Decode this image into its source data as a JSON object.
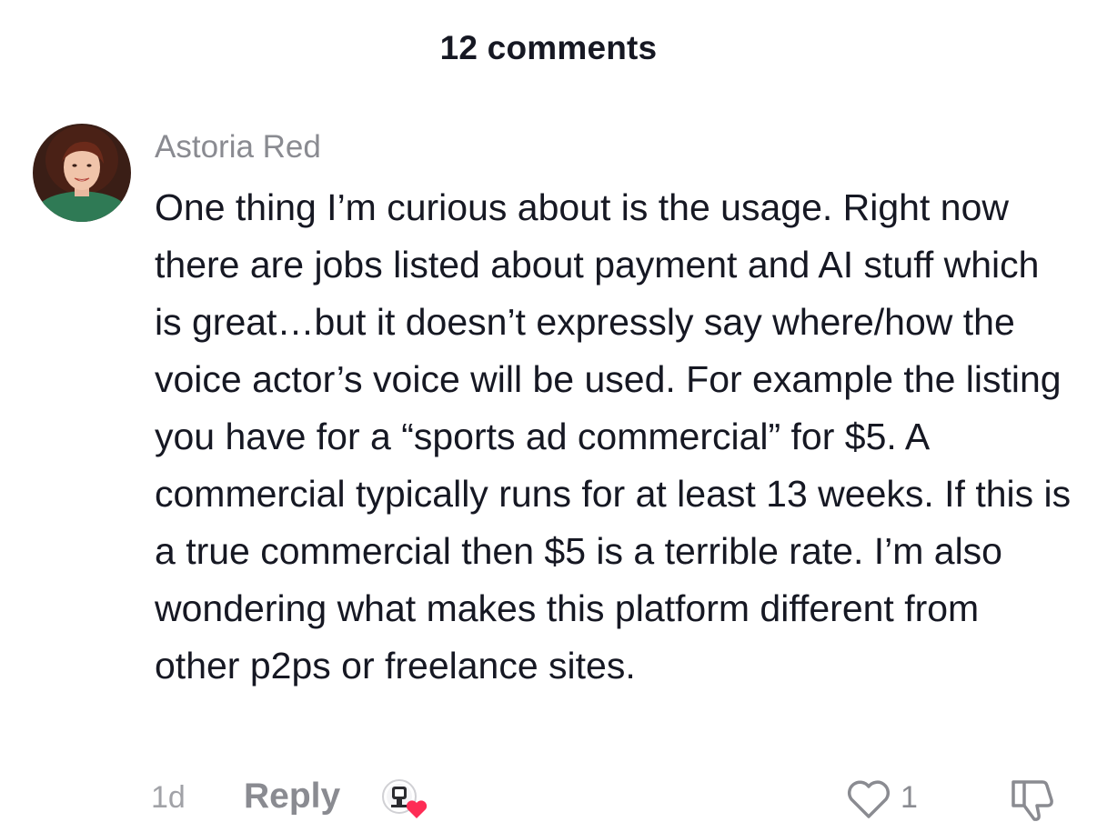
{
  "header": {
    "title": "12 comments"
  },
  "comment": {
    "author": "Astoria Red",
    "text": "One thing I’m curious about is the usage. Right now there are jobs listed about payment and AI stuff which is great…but it doesn’t expressly say where/how the voice actor’s voice will be used. For example the listing you have for a “sports ad commercial” for $5. A commercial typically runs for at least 13 weeks. If this is a true commercial then $5 is a terrible rate. I’m also wondering what makes this platform different from other p2ps or freelance sites.",
    "timestamp": "1d",
    "reply_label": "Reply",
    "like_count": "1",
    "avatar_icon": "profile-photo",
    "creator_liked_icon": "creator-avatar-heart-icon",
    "like_icon": "heart-outline-icon",
    "dislike_icon": "thumbs-down-icon"
  },
  "colors": {
    "primary_text": "#161823",
    "secondary_text": "#8a8b91",
    "creator_heart": "#fe2c55"
  }
}
